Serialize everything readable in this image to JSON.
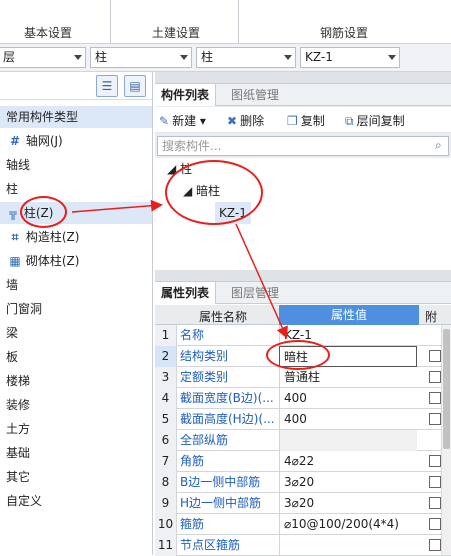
{
  "ribbon": {
    "groups": [
      "基本设置",
      "土建设置",
      "钢筋设置"
    ]
  },
  "combos": [
    "层",
    "柱",
    "柱",
    "KZ-1"
  ],
  "left_tree": {
    "root": "常用构件类型",
    "items": [
      {
        "label": "轴网(J)",
        "icon": "grid-axis-icon"
      },
      {
        "label": "轴线"
      },
      {
        "label": "柱"
      },
      {
        "label": "柱(Z)",
        "icon": "column-icon"
      },
      {
        "label": "构造柱(Z)",
        "icon": "structural-column-icon"
      },
      {
        "label": "砌体柱(Z)",
        "icon": "masonry-column-icon"
      },
      {
        "label": "墙"
      },
      {
        "label": "门窗洞"
      },
      {
        "label": "梁"
      },
      {
        "label": "板"
      },
      {
        "label": "楼梯"
      },
      {
        "label": "装修"
      },
      {
        "label": "土方"
      },
      {
        "label": "基础"
      },
      {
        "label": "其它"
      },
      {
        "label": "自定义"
      }
    ]
  },
  "component_panel": {
    "tabs": [
      "构件列表",
      "图纸管理"
    ],
    "toolbar": [
      "新建",
      "删除",
      "复制",
      "层间复制"
    ],
    "search_placeholder": "搜索构件...",
    "tree": {
      "root": "柱",
      "child": "暗柱",
      "leaf": "KZ-1"
    }
  },
  "property_panel": {
    "tabs": [
      "属性列表",
      "图层管理"
    ],
    "headers": [
      "属性名称",
      "属性值",
      "附"
    ],
    "rows": [
      {
        "num": "1",
        "name": "名称",
        "value": "KZ-1"
      },
      {
        "num": "2",
        "name": "结构类别",
        "value": "暗柱"
      },
      {
        "num": "3",
        "name": "定额类别",
        "value": "普通柱"
      },
      {
        "num": "4",
        "name": "截面宽度(B边)(...",
        "value": "400"
      },
      {
        "num": "5",
        "name": "截面高度(H边)(...",
        "value": "400"
      },
      {
        "num": "6",
        "name": "全部纵筋",
        "value": ""
      },
      {
        "num": "7",
        "name": "角筋",
        "value": "4⌀22"
      },
      {
        "num": "8",
        "name": "B边一侧中部筋",
        "value": "3⌀20"
      },
      {
        "num": "9",
        "name": "H边一侧中部筋",
        "value": "3⌀20"
      },
      {
        "num": "10",
        "name": "箍筋",
        "value": "⌀10@100/200(4*4)"
      },
      {
        "num": "11",
        "name": "节点区箍筋",
        "value": ""
      }
    ]
  },
  "colors": {
    "accent": "#1d5fbf",
    "highlight": "#dce8f8",
    "annotation": "#e8201d",
    "header_blue": "#4f8fe0"
  }
}
